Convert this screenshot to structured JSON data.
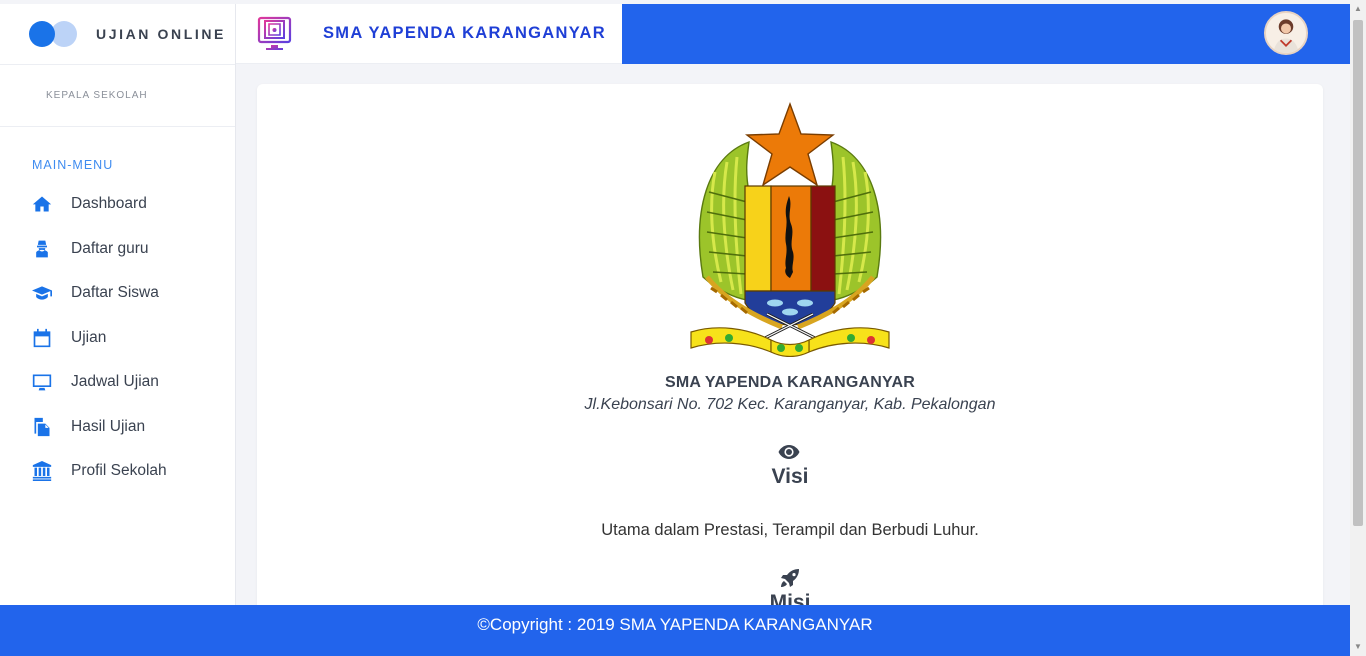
{
  "app": {
    "title": "UJIAN ONLINE",
    "role": "KEPALA SEKOLAH"
  },
  "header": {
    "school_title": "SMA YAPENDA KARANGANYAR"
  },
  "sidebar": {
    "menu_heading": "MAIN-MENU",
    "items": [
      {
        "label": "Dashboard",
        "icon": "home-icon"
      },
      {
        "label": "Daftar guru",
        "icon": "teacher-icon"
      },
      {
        "label": "Daftar Siswa",
        "icon": "graduation-cap-icon"
      },
      {
        "label": "Ujian",
        "icon": "calendar-icon"
      },
      {
        "label": "Jadwal Ujian",
        "icon": "desktop-icon"
      },
      {
        "label": "Hasil Ujian",
        "icon": "copy-icon"
      },
      {
        "label": "Profil Sekolah",
        "icon": "university-icon"
      }
    ]
  },
  "content": {
    "school_name": "SMA YAPENDA KARANGANYAR",
    "address": "Jl.Kebonsari No. 702 Kec. Karanganyar, Kab. Pekalongan",
    "visi_heading": "Visi",
    "visi_text": "Utama dalam Prestasi, Terampil dan Berbudi Luhur.",
    "misi_heading": "Misi"
  },
  "footer": {
    "copyright": "©Copyright : 2019 SMA YAPENDA KARANGANYAR"
  },
  "colors": {
    "primary": "#2264ec",
    "accent": "#1a73e8",
    "menu_heading": "#3f8cf0"
  }
}
